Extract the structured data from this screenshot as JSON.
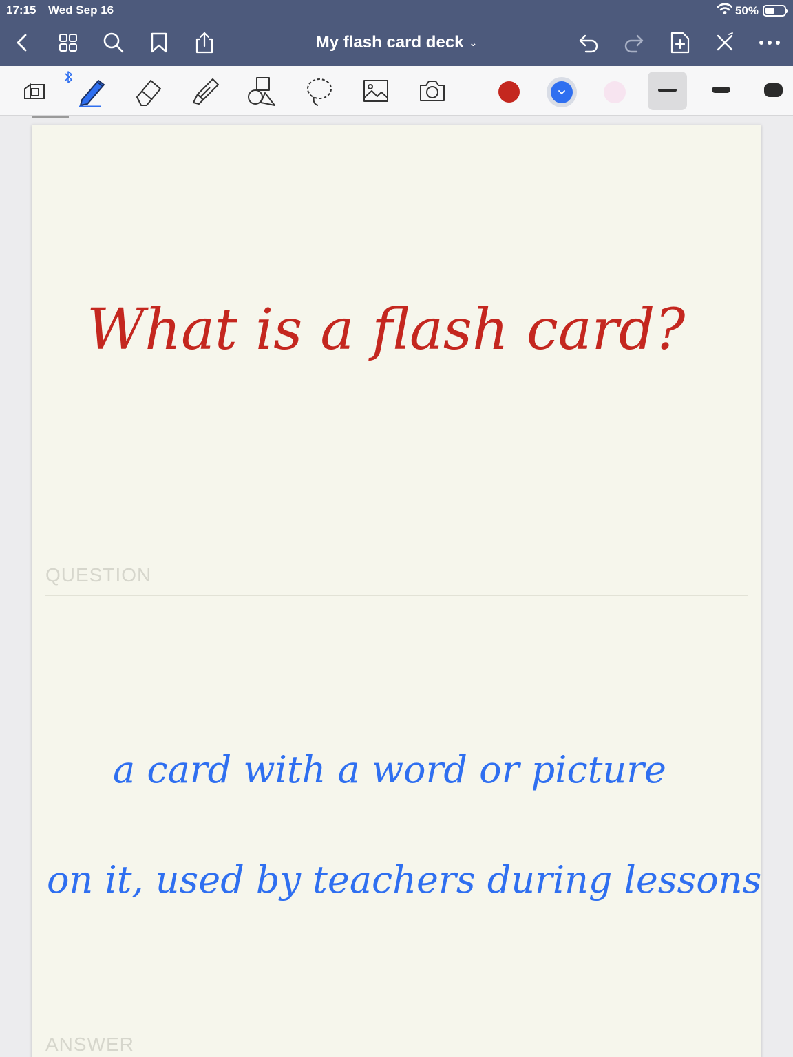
{
  "status": {
    "time": "17:15",
    "date": "Wed Sep 16",
    "battery_text": "50%",
    "battery_level": 0.5
  },
  "nav": {
    "title": "My flash card deck",
    "icons": [
      "back-icon",
      "thumbnails-icon",
      "search-icon",
      "bookmark-icon",
      "share-icon",
      "undo-icon",
      "redo-icon",
      "add-page-icon",
      "close-edit-icon",
      "more-icon"
    ]
  },
  "tools": {
    "icons": [
      "reading-mode-icon",
      "bluetooth-icon",
      "pen-icon",
      "eraser-icon",
      "highlighter-icon",
      "shapes-icon",
      "lasso-icon",
      "image-icon",
      "camera-icon"
    ],
    "colors": {
      "red": "#c4271f",
      "blue": "#2f6ff0",
      "pink": "#f7e4f0"
    },
    "selected_color": "blue"
  },
  "card": {
    "question_label": "QUESTION",
    "answer_label": "ANSWER",
    "question_text": "What is a flash card?",
    "answer_line1": "a card with a word or picture",
    "answer_line2": "on it, used by teachers during lessons",
    "question_color": "#c4271f",
    "answer_color": "#2f6ff0"
  }
}
